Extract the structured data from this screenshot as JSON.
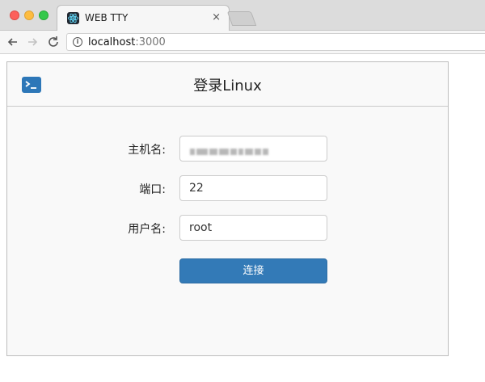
{
  "browser": {
    "tab_title": "WEB TTY",
    "tab_close": "×",
    "url_host": "localhost",
    "url_port": ":3000"
  },
  "panel": {
    "title": "登录Linux"
  },
  "form": {
    "host_label": "主机名:",
    "port_label": "端口:",
    "port_value": "22",
    "user_label": "用户名:",
    "user_value": "root",
    "connect_label": "连接"
  },
  "colors": {
    "accent": "#337ab7",
    "panel_bg": "#f9f9f9",
    "favicon_bg": "#222831",
    "react_logo": "#61dafb"
  },
  "icons": {
    "favicon": "react-logo-icon",
    "panel_icon": "terminal-icon",
    "back": "arrow-left-icon",
    "forward": "arrow-right-icon",
    "reload": "reload-icon",
    "info": "info-icon"
  }
}
